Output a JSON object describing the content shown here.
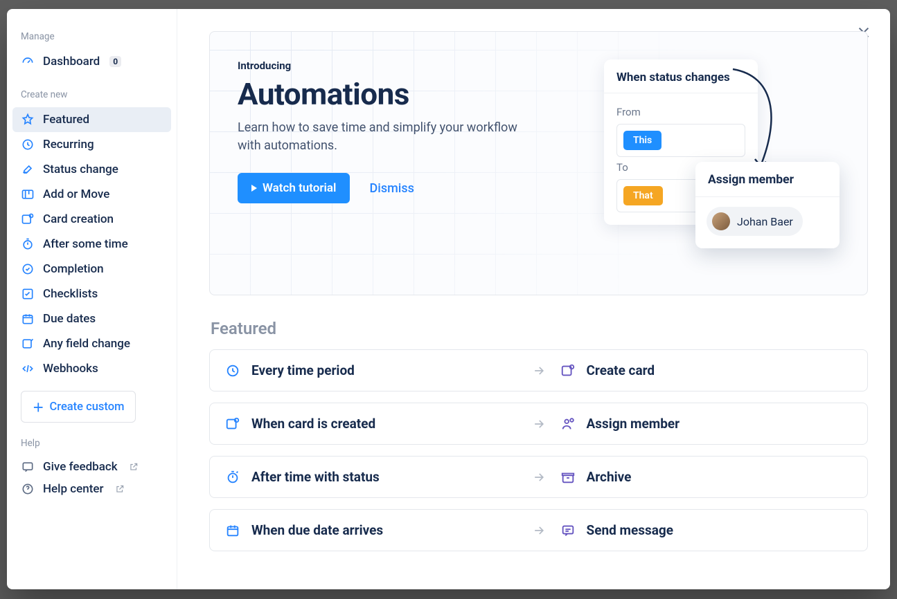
{
  "sidebar": {
    "manage_label": "Manage",
    "dashboard": {
      "label": "Dashboard",
      "badge": "0"
    },
    "create_label": "Create new",
    "items": [
      {
        "label": "Featured"
      },
      {
        "label": "Recurring"
      },
      {
        "label": "Status change"
      },
      {
        "label": "Add or Move"
      },
      {
        "label": "Card creation"
      },
      {
        "label": "After some time"
      },
      {
        "label": "Completion"
      },
      {
        "label": "Checklists"
      },
      {
        "label": "Due dates"
      },
      {
        "label": "Any field change"
      },
      {
        "label": "Webhooks"
      }
    ],
    "create_custom": "Create custom",
    "help_label": "Help",
    "give_feedback": "Give feedback",
    "help_center": "Help center"
  },
  "hero": {
    "intro": "Introducing",
    "title": "Automations",
    "subtitle": "Learn how to save time and simplify your workflow with automations.",
    "watch": "Watch tutorial",
    "dismiss": "Dismiss",
    "card_status_title": "When status changes",
    "from_label": "From",
    "to_label": "To",
    "token_this": "This",
    "token_that": "That",
    "assign_title": "Assign member",
    "member_name": "Johan Baer"
  },
  "section_title": "Featured",
  "automations": [
    {
      "trigger": "Every time period",
      "action": "Create card"
    },
    {
      "trigger": "When card is created",
      "action": "Assign member"
    },
    {
      "trigger": "After time with status",
      "action": "Archive"
    },
    {
      "trigger": "When due date arrives",
      "action": "Send message"
    }
  ]
}
